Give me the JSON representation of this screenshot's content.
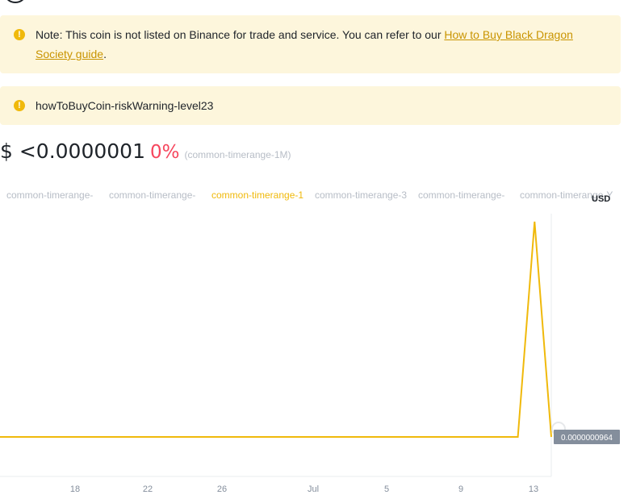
{
  "notices": [
    {
      "text": "Note: This coin is not listed on Binance for trade and service. You can refer to our ",
      "link_text": "How to Buy Black Dragon Society guide",
      "suffix": "."
    },
    {
      "text": "howToBuyCoin-riskWarning-level23"
    }
  ],
  "price": {
    "value": "$ <0.0000001",
    "change": "0%",
    "range": "(common-timerange-1M)"
  },
  "time_tabs": [
    {
      "label": "common-timerange-",
      "active": false
    },
    {
      "label": "common-timerange-",
      "active": false
    },
    {
      "label": "common-timerange-1",
      "active": true
    },
    {
      "label": "common-timerange-3",
      "active": false
    },
    {
      "label": "common-timerange-",
      "active": false
    },
    {
      "label": "common-timerange-Y",
      "active": false
    }
  ],
  "currency": "USD",
  "chart_data": {
    "type": "line",
    "x_ticks": [
      "18",
      "22",
      "26",
      "Jul",
      "5",
      "9",
      "13"
    ],
    "last_value_label": "0.0000000964",
    "series": [
      {
        "values": [
          9.64e-08,
          9.64e-08,
          9.64e-08,
          9.64e-08,
          9.64e-08,
          9.64e-08,
          9.64e-08,
          9.64e-08,
          9.64e-08,
          9.64e-08,
          9.64e-08,
          9.64e-08,
          9.64e-08,
          9.64e-08,
          9.64e-08,
          9.64e-08,
          9.64e-08,
          9.64e-08,
          9.64e-08,
          9.64e-08,
          9.64e-08,
          9.64e-08,
          9.64e-08,
          9.64e-08,
          9.64e-08,
          9.64e-08,
          9.64e-08,
          9.64e-08,
          9.64e-08,
          9.64e-08,
          9.64e-08,
          9.64e-08,
          1e-06,
          9.64e-08
        ]
      }
    ],
    "line_color": "#f0b90b",
    "price_tag_color": "#848e9c"
  }
}
